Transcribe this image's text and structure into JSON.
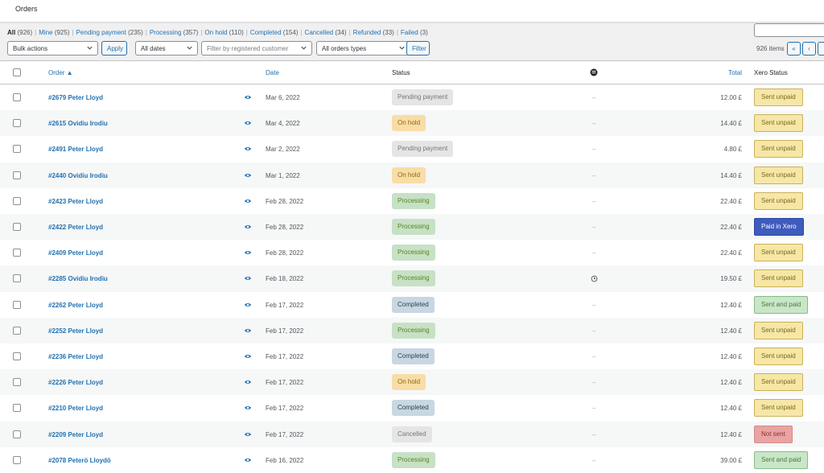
{
  "header": {
    "title": "Orders"
  },
  "views": [
    {
      "label": "All",
      "count": "(926)",
      "current": true
    },
    {
      "label": "Mine",
      "count": "(925)"
    },
    {
      "label": "Pending payment",
      "count": "(235)"
    },
    {
      "label": "Processing",
      "count": "(357)"
    },
    {
      "label": "On hold",
      "count": "(110)"
    },
    {
      "label": "Completed",
      "count": "(154)"
    },
    {
      "label": "Cancelled",
      "count": "(34)"
    },
    {
      "label": "Refunded",
      "count": "(33)"
    },
    {
      "label": "Failed",
      "count": "(3)"
    }
  ],
  "toolbar": {
    "bulk_actions": "Bulk actions",
    "apply": "Apply",
    "all_dates": "All dates",
    "customer_placeholder": "Filter by registered customer",
    "order_types": "All orders types",
    "filter": "Filter"
  },
  "pagination": {
    "items": "926 items",
    "first": "«",
    "prev": "‹"
  },
  "columns": {
    "order": "Order ▲",
    "date": "Date",
    "status": "Status",
    "total": "Total",
    "xero": "Xero Status"
  },
  "orders": [
    {
      "order": "#2679 Peter Lloyd",
      "date": "Mar 6, 2022",
      "status": "Pending payment",
      "status_key": "pending",
      "origin": "–",
      "total": "12.00 £",
      "xero": "Sent unpaid",
      "xero_key": "unpaid"
    },
    {
      "order": "#2615 Ovidiu Irodiu",
      "date": "Mar 4, 2022",
      "status": "On hold",
      "status_key": "hold",
      "origin": "–",
      "total": "14.40 £",
      "xero": "Sent unpaid",
      "xero_key": "unpaid"
    },
    {
      "order": "#2491 Peter Lloyd",
      "date": "Mar 2, 2022",
      "status": "Pending payment",
      "status_key": "pending",
      "origin": "–",
      "total": "4.80 £",
      "xero": "Sent unpaid",
      "xero_key": "unpaid"
    },
    {
      "order": "#2440 Ovidiu Irodiu",
      "date": "Mar 1, 2022",
      "status": "On hold",
      "status_key": "hold",
      "origin": "–",
      "total": "14.40 £",
      "xero": "Sent unpaid",
      "xero_key": "unpaid"
    },
    {
      "order": "#2423 Peter Lloyd",
      "date": "Feb 28, 2022",
      "status": "Processing",
      "status_key": "processing",
      "origin": "–",
      "total": "22.40 £",
      "xero": "Sent unpaid",
      "xero_key": "unpaid"
    },
    {
      "order": "#2422 Peter Lloyd",
      "date": "Feb 28, 2022",
      "status": "Processing",
      "status_key": "processing",
      "origin": "–",
      "total": "22.40 £",
      "xero": "Paid in Xero",
      "xero_key": "paidxero"
    },
    {
      "order": "#2409 Peter Lloyd",
      "date": "Feb 28, 2022",
      "status": "Processing",
      "status_key": "processing",
      "origin": "–",
      "total": "22.40 £",
      "xero": "Sent unpaid",
      "xero_key": "unpaid"
    },
    {
      "order": "#2285 Ovidiu Irodiu",
      "date": "Feb 18, 2022",
      "status": "Processing",
      "status_key": "processing",
      "origin": "clock",
      "total": "19.50 £",
      "xero": "Sent unpaid",
      "xero_key": "unpaid"
    },
    {
      "order": "#2262 Peter Lloyd",
      "date": "Feb 17, 2022",
      "status": "Completed",
      "status_key": "completed",
      "origin": "–",
      "total": "12.40 £",
      "xero": "Sent and paid",
      "xero_key": "sentpaid"
    },
    {
      "order": "#2252 Peter Lloyd",
      "date": "Feb 17, 2022",
      "status": "Processing",
      "status_key": "processing",
      "origin": "–",
      "total": "12.40 £",
      "xero": "Sent unpaid",
      "xero_key": "unpaid"
    },
    {
      "order": "#2236 Peter Lloyd",
      "date": "Feb 17, 2022",
      "status": "Completed",
      "status_key": "completed",
      "origin": "–",
      "total": "12.40 £",
      "xero": "Sent unpaid",
      "xero_key": "unpaid"
    },
    {
      "order": "#2226 Peter Lloyd",
      "date": "Feb 17, 2022",
      "status": "On hold",
      "status_key": "hold",
      "origin": "–",
      "total": "12.40 £",
      "xero": "Sent unpaid",
      "xero_key": "unpaid"
    },
    {
      "order": "#2210 Peter Lloyd",
      "date": "Feb 17, 2022",
      "status": "Completed",
      "status_key": "completed",
      "origin": "–",
      "total": "12.40 £",
      "xero": "Sent unpaid",
      "xero_key": "unpaid"
    },
    {
      "order": "#2209 Peter Lloyd",
      "date": "Feb 17, 2022",
      "status": "Cancelled",
      "status_key": "cancelled",
      "origin": "–",
      "total": "12.40 £",
      "xero": "Not sent",
      "xero_key": "notsent"
    },
    {
      "order": "#2078 Peterö Lloydö",
      "date": "Feb 16, 2022",
      "status": "Processing",
      "status_key": "processing",
      "origin": "–",
      "total": "39.00 £",
      "xero": "Sent and paid",
      "xero_key": "sentpaid"
    }
  ]
}
